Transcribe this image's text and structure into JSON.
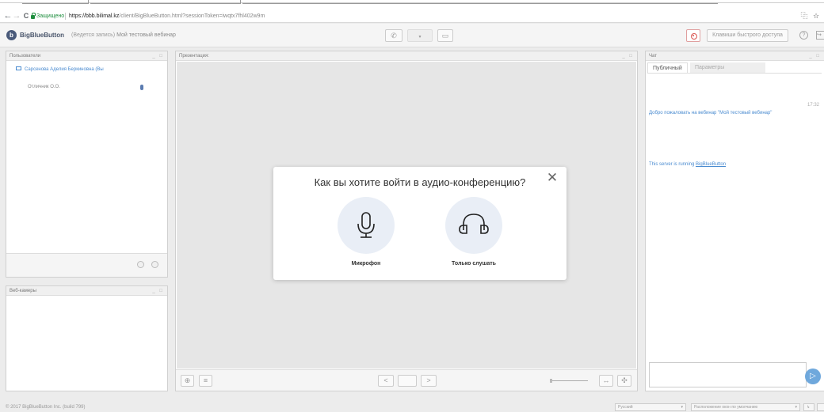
{
  "browser": {
    "nav": {
      "back": "←",
      "forward": "→",
      "reload": "C"
    },
    "secure_label": "Защищено",
    "url_host": "https://bbb.bilimal.kz",
    "url_path": "/client/BigBlueButton.html?sessionToken=iwqtx7fhl402w9m",
    "ext_icons": [
      "translate-icon",
      "star-icon"
    ],
    "ext_glyphs": [
      "⿻",
      "☆"
    ]
  },
  "header": {
    "logo_letter": "b",
    "logo_text": "BigBlueButton",
    "recording_text": "(Ведется запись)",
    "meeting_title": "Мой тестовый вебинар",
    "phone_glyph": "✆",
    "webcam_glyph": "▭",
    "shortcut_label": "Клавиши быстрого доступа",
    "help_glyph": "?",
    "logout_glyph": "↪"
  },
  "users_panel": {
    "title": "Пользователи",
    "controls": "_ □",
    "users": [
      {
        "name": "Сарсенова Аделия Беркиновна (Вы",
        "role": "presenter"
      },
      {
        "name": "Отличник О.О.",
        "role": "viewer"
      }
    ]
  },
  "webcams_panel": {
    "title": "Веб-камеры",
    "controls": "_ □"
  },
  "presentation_panel": {
    "title": "Презентация:",
    "controls": "_ □",
    "prev_glyph": "<",
    "next_glyph": ">",
    "fit_width_glyph": "↔",
    "fit_page_glyph": "✣"
  },
  "chat_panel": {
    "title": "Чат",
    "controls": "_ □",
    "tabs": [
      {
        "label": "Публичный",
        "active": true
      },
      {
        "label": "Параметры",
        "active": false
      }
    ],
    "messages": [
      {
        "time": "17:32",
        "text": "Добро пожаловать на вебинар \"Мой тестовый вебинар\""
      },
      {
        "prefix": "This server is running ",
        "link": "BigBlueButton"
      }
    ],
    "send_glyph": "▷"
  },
  "footer": {
    "copyright": "© 2017 BigBlueButton Inc. (build 799)",
    "language": "Русский",
    "layout": "Расположение окон по умолчанию"
  },
  "audio_modal": {
    "title": "Как вы хотите войти в аудио-конференцию?",
    "close_glyph": "✕",
    "options": [
      {
        "label": "Микрофон",
        "icon": "microphone-icon"
      },
      {
        "label": "Только слушать",
        "icon": "headphones-icon"
      }
    ]
  },
  "colors": {
    "accent": "#4a5a7a",
    "secure_green": "#1e8e3e",
    "link_blue": "#4a8bd0",
    "record_red": "#d9534f",
    "modal_circle": "#e9eef6",
    "send_button": "#6fa8dc"
  }
}
